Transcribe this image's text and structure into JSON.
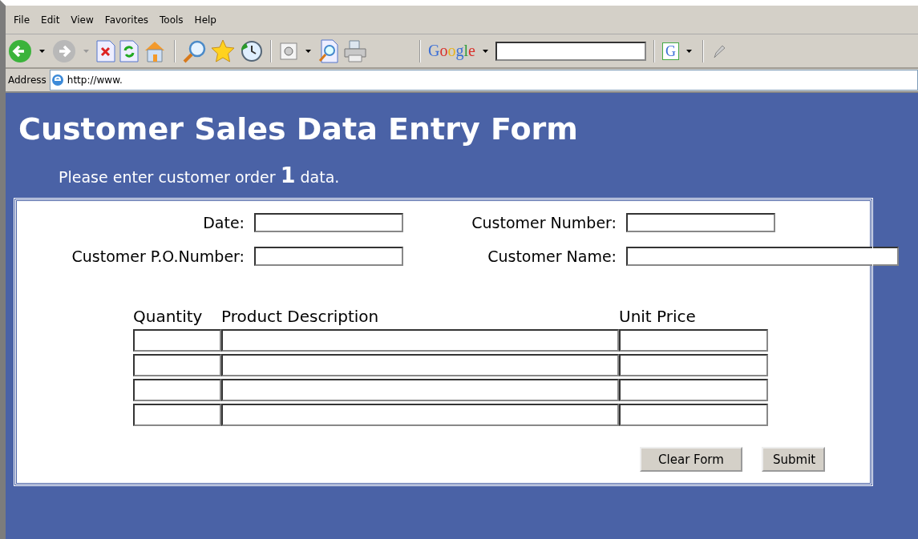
{
  "menu": [
    "File",
    "Edit",
    "View",
    "Favorites",
    "Tools",
    "Help"
  ],
  "address_bar": {
    "label": "Address",
    "url": "http://www."
  },
  "google_toolbar": {
    "logo": "Google",
    "button": "G"
  },
  "page": {
    "title": "Customer Sales Data Entry Form",
    "prompt": "Please enter customer order **1** data."
  },
  "form": {
    "fields": [
      {
        "label": "Date:",
        "kind": "short"
      },
      {
        "label": "Customer Number:",
        "kind": "short"
      },
      {
        "label": "Customer P.O.Number:",
        "kind": "short"
      },
      {
        "label": "Customer Name:",
        "kind": "long"
      }
    ],
    "table": {
      "columns": [
        "Quantity",
        "Product Description",
        "Unit Price"
      ]
    },
    "buttons": [
      "Clear Form",
      "Submit"
    ]
  }
}
